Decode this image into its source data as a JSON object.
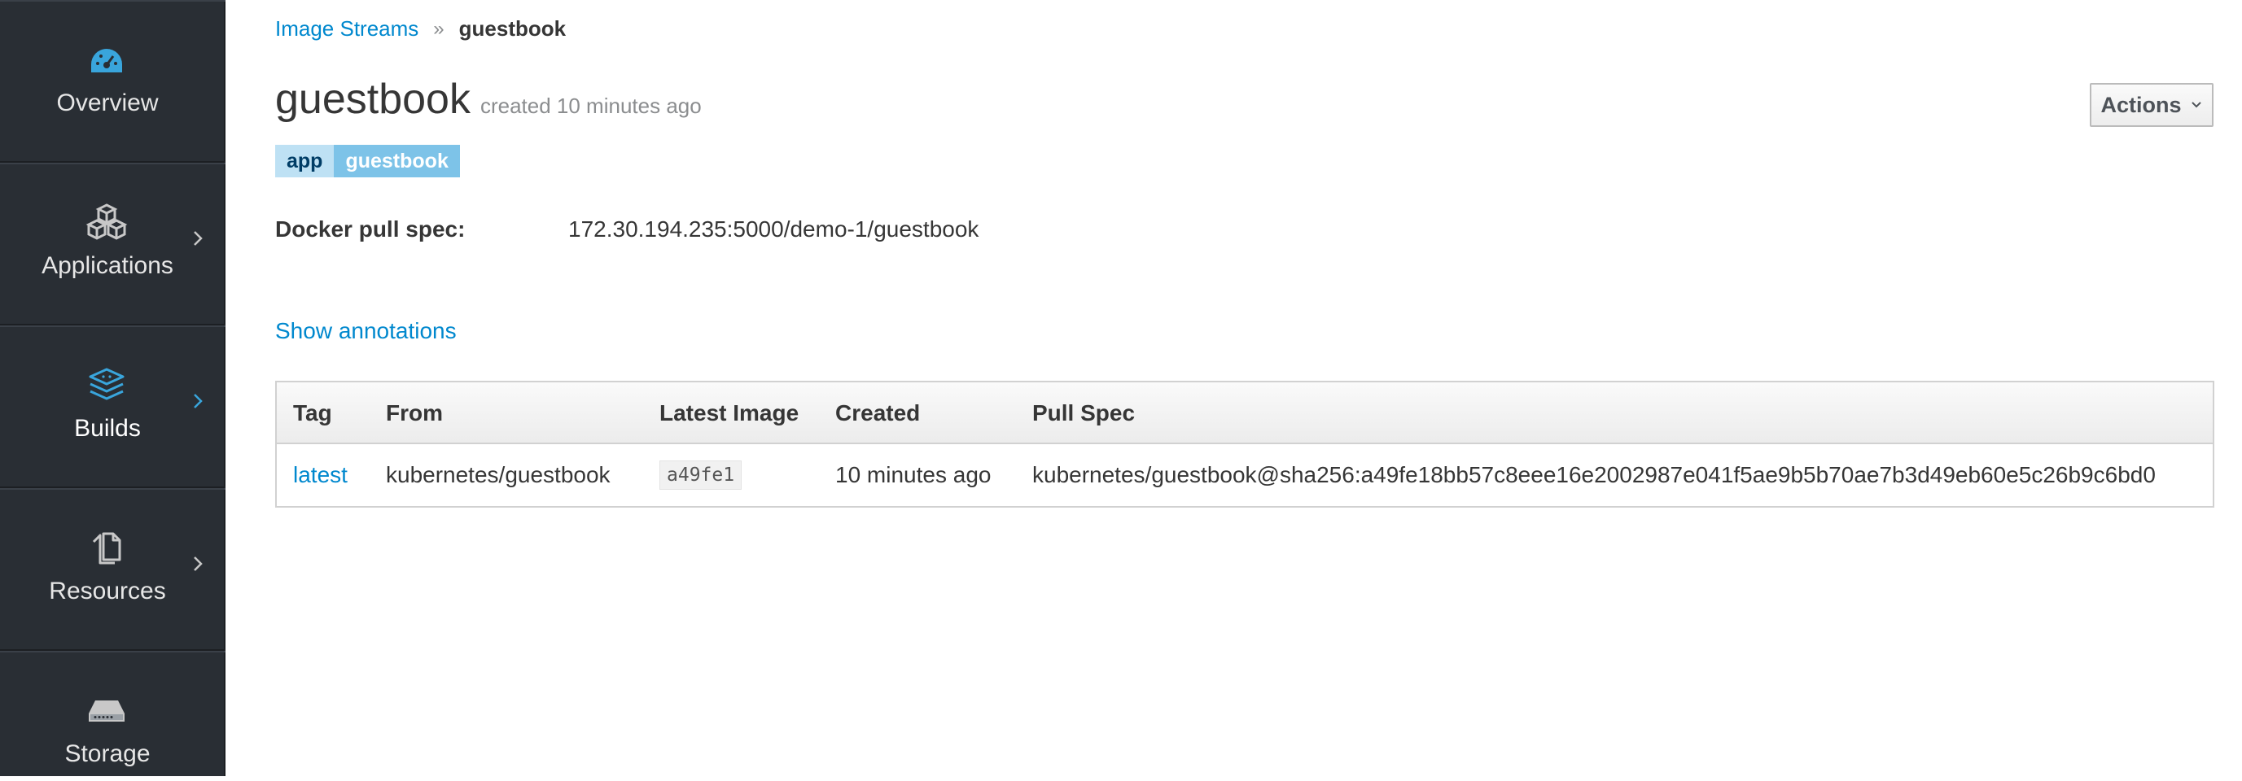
{
  "sidebar": {
    "items": [
      {
        "label": "Overview",
        "icon": "dashboard-icon",
        "active": true,
        "has_chevron": false
      },
      {
        "label": "Applications",
        "icon": "cubes-icon",
        "active": false,
        "has_chevron": true
      },
      {
        "label": "Builds",
        "icon": "layers-icon",
        "active": true,
        "has_chevron": true
      },
      {
        "label": "Resources",
        "icon": "copy-icon",
        "active": false,
        "has_chevron": true
      },
      {
        "label": "Storage",
        "icon": "hdd-icon",
        "active": false,
        "has_chevron": false
      }
    ]
  },
  "breadcrumb": {
    "parent": "Image Streams",
    "current": "guestbook"
  },
  "header": {
    "title": "guestbook",
    "subtitle": "created 10 minutes ago",
    "actions_label": "Actions"
  },
  "labels": [
    {
      "key": "app",
      "value": "guestbook"
    }
  ],
  "details": {
    "docker_pull_spec_label": "Docker pull spec:",
    "docker_pull_spec_value": "172.30.194.235:5000/demo-1/guestbook"
  },
  "show_annotations": "Show annotations",
  "table": {
    "headers": [
      "Tag",
      "From",
      "Latest Image",
      "Created",
      "Pull Spec"
    ],
    "rows": [
      {
        "tag": "latest",
        "from": "kubernetes/guestbook",
        "latest_image": "a49fe1",
        "created": "10 minutes ago",
        "pull_spec": "kubernetes/guestbook@sha256:a49fe18bb57c8eee16e2002987e041f5ae9b5b70ae7b3d49eb60e5c26b9c6bd0"
      }
    ]
  },
  "colors": {
    "accent": "#0088ce",
    "sidebar_bg": "#292e34",
    "active_icon": "#39a5dc"
  }
}
